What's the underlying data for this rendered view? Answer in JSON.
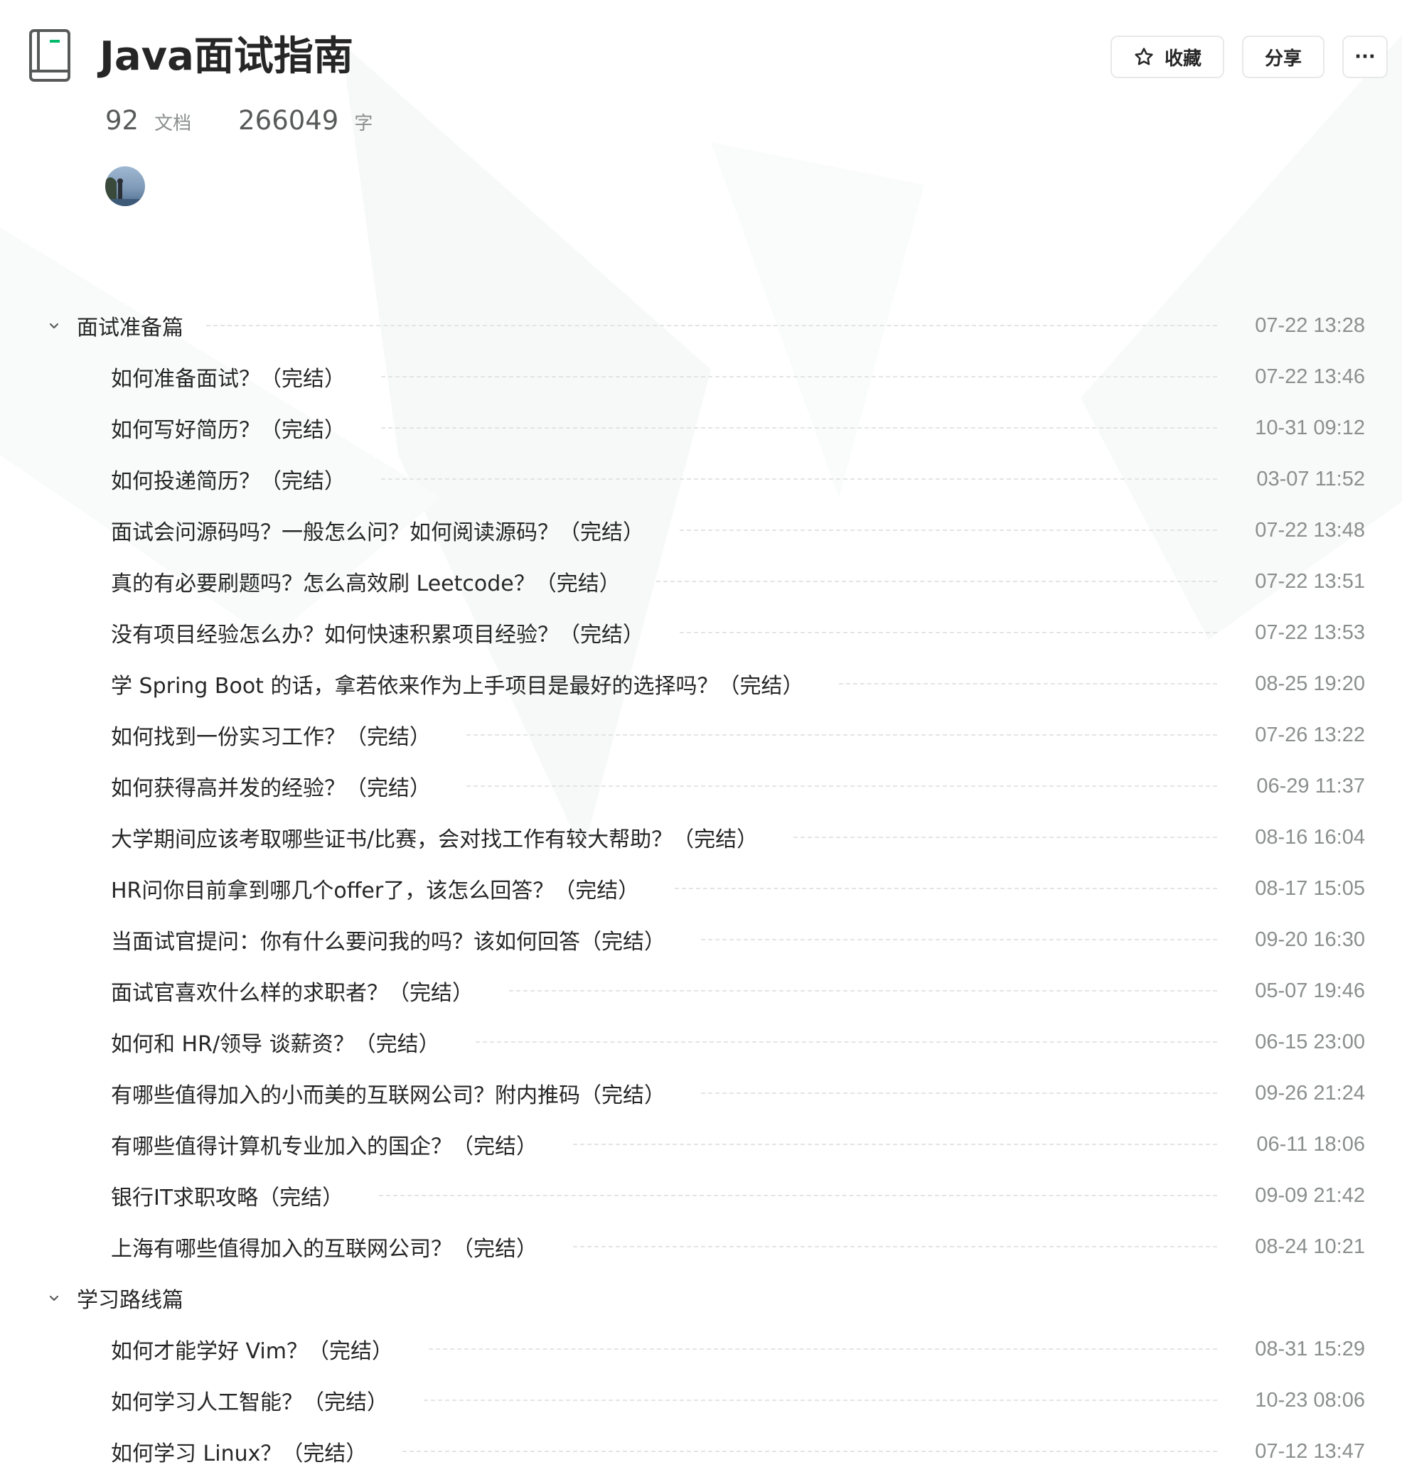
{
  "book": {
    "title": "Java面试指南",
    "doc_count": "92",
    "doc_unit": "文档",
    "word_count": "266049",
    "word_unit": "字"
  },
  "actions": {
    "favorite_label": "收藏",
    "share_label": "分享",
    "more_label": "···"
  },
  "groups": [
    {
      "title": "面试准备篇",
      "time": "07-22 13:28",
      "items": [
        {
          "title": "如何准备面试？（完结）",
          "time": "07-22 13:46"
        },
        {
          "title": "如何写好简历？（完结）",
          "time": "10-31 09:12"
        },
        {
          "title": "如何投递简历？（完结）",
          "time": "03-07 11:52"
        },
        {
          "title": "面试会问源码吗？一般怎么问？如何阅读源码？（完结）",
          "time": "07-22 13:48"
        },
        {
          "title": "真的有必要刷题吗？怎么高效刷 Leetcode？（完结）",
          "time": "07-22 13:51"
        },
        {
          "title": "没有项目经验怎么办？如何快速积累项目经验？（完结）",
          "time": "07-22 13:53"
        },
        {
          "title": "学 Spring Boot 的话，拿若依来作为上手项目是最好的选择吗？（完结）",
          "time": "08-25 19:20"
        },
        {
          "title": "如何找到一份实习工作？（完结）",
          "time": "07-26 13:22"
        },
        {
          "title": "如何获得高并发的经验？（完结）",
          "time": "06-29 11:37"
        },
        {
          "title": "大学期间应该考取哪些证书/比赛，会对找工作有较大帮助？（完结）",
          "time": "08-16 16:04"
        },
        {
          "title": "HR问你目前拿到哪几个offer了，该怎么回答？（完结）",
          "time": "08-17 15:05"
        },
        {
          "title": "当面试官提问：你有什么要问我的吗？该如何回答（完结）",
          "time": "09-20 16:30"
        },
        {
          "title": "面试官喜欢什么样的求职者？（完结）",
          "time": "05-07 19:46"
        },
        {
          "title": "如何和 HR/领导 谈薪资？（完结）",
          "time": "06-15 23:00"
        },
        {
          "title": "有哪些值得加入的小而美的互联网公司？附内推码（完结）",
          "time": "09-26 21:24"
        },
        {
          "title": "有哪些值得计算机专业加入的国企？（完结）",
          "time": "06-11 18:06"
        },
        {
          "title": "银行IT求职攻略（完结）",
          "time": "09-09 21:42"
        },
        {
          "title": "上海有哪些值得加入的互联网公司？（完结）",
          "time": "08-24 10:21"
        }
      ]
    },
    {
      "title": "学习路线篇",
      "time": "",
      "items": [
        {
          "title": "如何才能学好 Vim？（完结）",
          "time": "08-31 15:29"
        },
        {
          "title": "如何学习人工智能？（完结）",
          "time": "10-23 08:06"
        },
        {
          "title": "如何学习 Linux？（完结）",
          "time": "07-12 13:47"
        }
      ]
    }
  ]
}
